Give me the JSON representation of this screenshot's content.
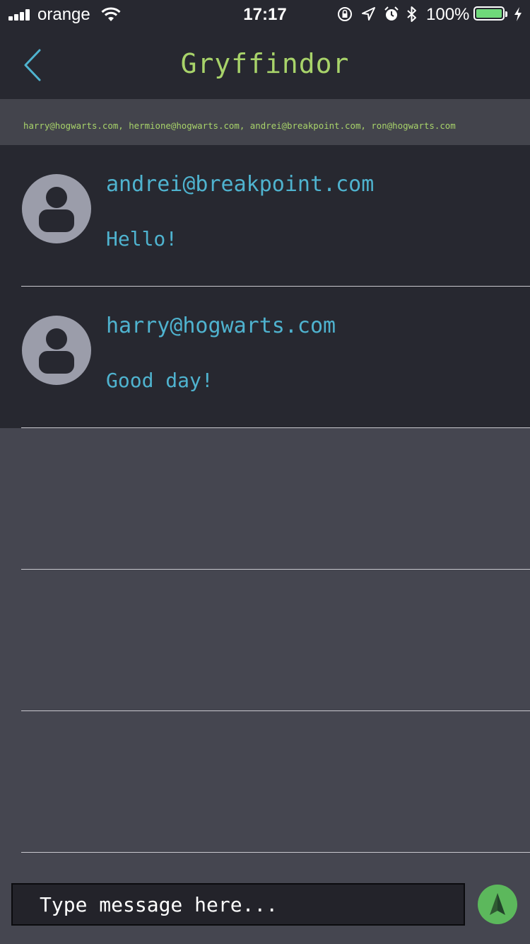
{
  "status_bar": {
    "carrier": "orange",
    "time": "17:17",
    "battery_percent": "100%",
    "battery_level": 1.0,
    "battery_color": "#6fd97a",
    "signal_bars": 4,
    "icons": [
      "signal-icon",
      "wifi-icon",
      "orientation-lock-icon",
      "location-icon",
      "alarm-icon",
      "bluetooth-icon",
      "battery-icon",
      "charging-icon"
    ]
  },
  "nav": {
    "title": "Gryffindor",
    "back_icon": "chevron-left-icon"
  },
  "participants": {
    "text": "harry@hogwarts.com, hermione@hogwarts.com, andrei@breakpoint.com, ron@hogwarts.com"
  },
  "messages": [
    {
      "sender": "andrei@breakpoint.com",
      "text": "Hello!",
      "avatar_icon": "user-avatar-icon"
    },
    {
      "sender": "harry@hogwarts.com",
      "text": "Good day!",
      "avatar_icon": "user-avatar-icon"
    }
  ],
  "empty_rows": 3,
  "composer": {
    "placeholder": "Type message here...",
    "value": "",
    "send_icon": "send-arrow-icon"
  },
  "colors": {
    "header_bg": "#272830",
    "list_bg": "#454650",
    "title_green": "#a8d36a",
    "message_blue": "#4fb3cf",
    "send_green": "#5cb85c"
  }
}
